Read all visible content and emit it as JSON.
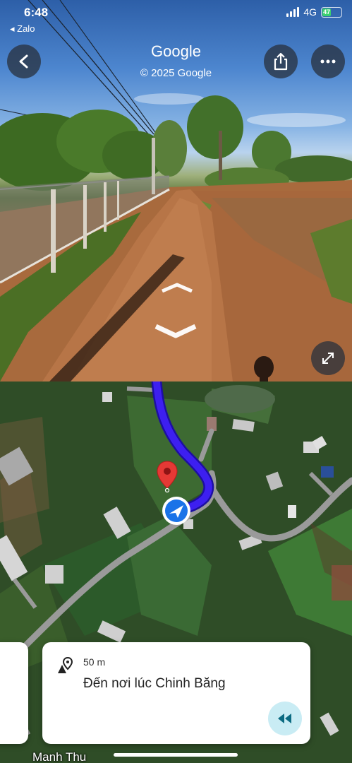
{
  "status_bar": {
    "time": "6:48",
    "back_app": "◂ Zalo",
    "network": "4G",
    "battery": "47"
  },
  "street_view": {
    "title": "Google",
    "copyright": "© 2025 Google",
    "back_icon": "chevron-left-icon",
    "share_icon": "share-icon",
    "more_icon": "more-horizontal-icon",
    "expand_icon": "expand-icon"
  },
  "navigation": {
    "distance": "50 m",
    "instruction": "Đến nơi lúc Chinh Băng",
    "route_color": "#3d1ff0",
    "pin_color": "#e53935",
    "location_color": "#1a73e8"
  },
  "map": {
    "street_label": "Manh Thu"
  }
}
